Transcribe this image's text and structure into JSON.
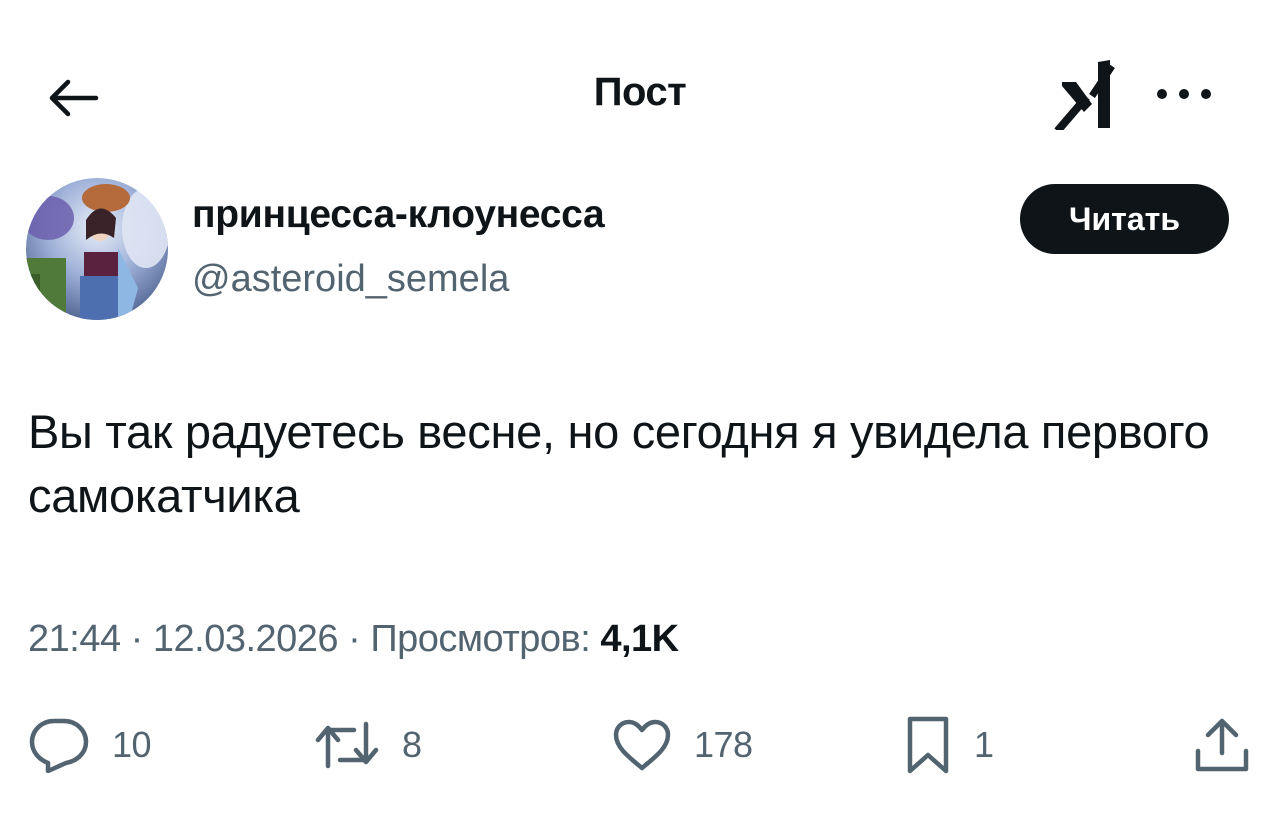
{
  "header": {
    "title": "Пост",
    "icons": {
      "back": "arrow-left-icon",
      "logo": "x-logo-icon",
      "more": "more-dots-icon"
    }
  },
  "author": {
    "display_name": "принцесса-клоунесса",
    "handle": "@asteroid_semela",
    "follow_label": "Читать"
  },
  "post": {
    "text": "Вы так радуетесь весне, но сегодня я увидела первого самокатчика"
  },
  "meta": {
    "time": "21:44",
    "sep1": " · ",
    "date": "12.03.2026",
    "sep2": " · ",
    "views_label": "Просмотров: ",
    "views_count": "4,1K"
  },
  "actions": {
    "reply_count": "10",
    "retweet_count": "8",
    "like_count": "178",
    "bookmark_count": "1"
  },
  "colors": {
    "text_primary": "#0f1419",
    "text_secondary": "#536471",
    "button_bg": "#0f1419",
    "button_text": "#ffffff",
    "background": "#ffffff"
  }
}
